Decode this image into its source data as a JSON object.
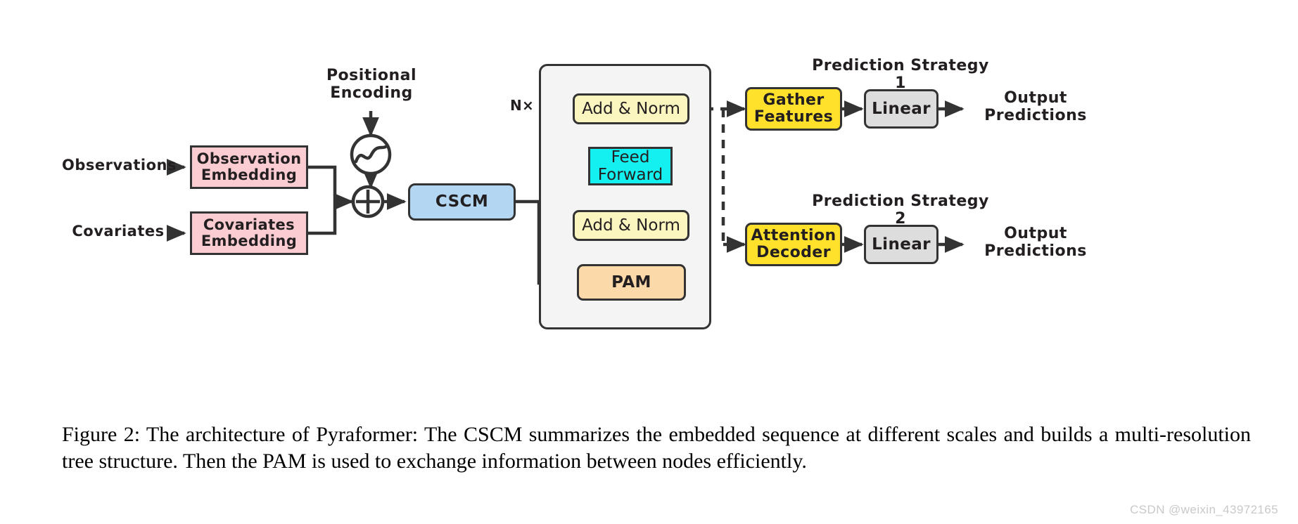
{
  "figure": {
    "caption": "Figure 2: The architecture of Pyraformer: The CSCM summarizes the embedded sequence at different scales and builds a multi-resolution tree structure. Then the PAM is used to exchange information between nodes efficiently.",
    "watermark": "CSDN @weixin_43972165"
  },
  "inputs": {
    "observations_label": "Observations",
    "covariates_label": "Covariates"
  },
  "embedding": {
    "observation_box": "Observation\nEmbedding",
    "covariates_box": "Covariates\nEmbedding"
  },
  "positional": {
    "title": "Positional\nEncoding",
    "sine_icon": "sine-wave-circle-icon",
    "sum_icon": "plus-circle-icon"
  },
  "cscm": {
    "label": "CSCM"
  },
  "encoder": {
    "repeat_label": "N×",
    "add_norm_top": "Add & Norm",
    "feed_forward": "Feed\nForward",
    "add_norm_bottom": "Add & Norm",
    "pam": "PAM"
  },
  "strategy1": {
    "title": "Prediction Strategy 1",
    "gather_features": "Gather\nFeatures",
    "linear": "Linear",
    "output": "Output\nPredictions"
  },
  "strategy2": {
    "title": "Prediction Strategy 2",
    "attention_decoder": "Attention\nDecoder",
    "linear": "Linear",
    "output": "Output\nPredictions"
  },
  "colors": {
    "embedding_pink": "#fbcdd2",
    "cscm_blue": "#b3d7f2",
    "add_norm_cream": "#fbf5c0",
    "feed_forward_cyan": "#14f0f0",
    "pam_orange": "#fcd9a8",
    "highlight_yellow": "#ffe02a",
    "linear_grey": "#dddddd",
    "panel_grey": "#f4f4f4",
    "stroke": "#333333"
  }
}
